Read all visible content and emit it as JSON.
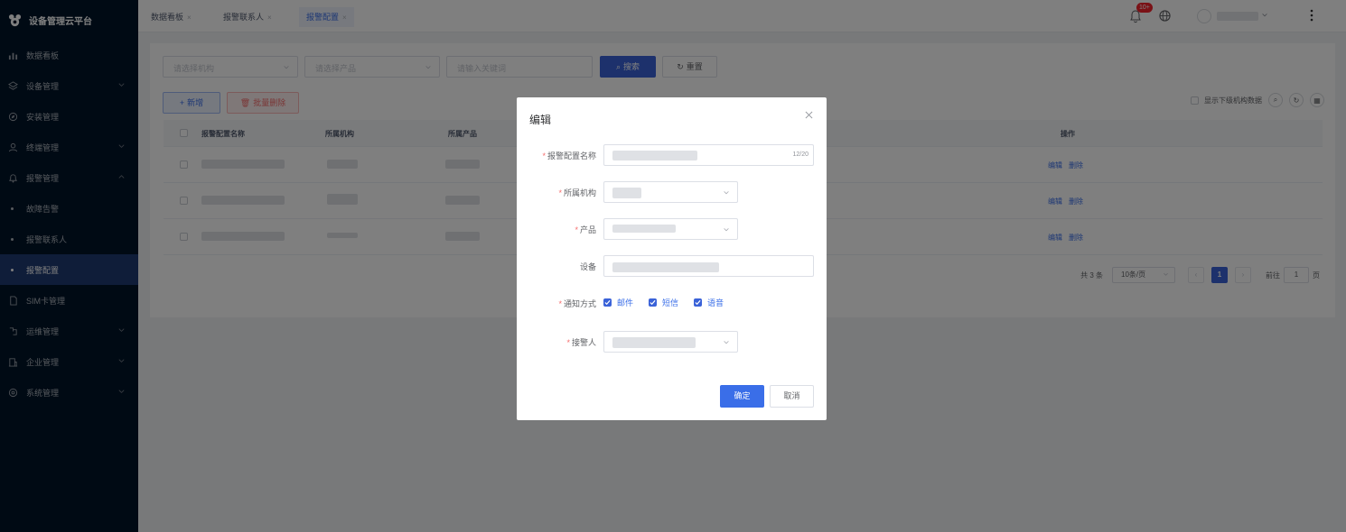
{
  "app": {
    "title": "设备管理云平台"
  },
  "sidebar": {
    "items": [
      {
        "label": "数据看板",
        "icon": "bar-chart-icon",
        "has_children": false
      },
      {
        "label": "设备管理",
        "icon": "layers-icon",
        "has_children": true
      },
      {
        "label": "安装管理",
        "icon": "compass-icon",
        "has_children": false
      },
      {
        "label": "终端管理",
        "icon": "user-icon",
        "has_children": true
      },
      {
        "label": "报警管理",
        "icon": "alarm-icon",
        "has_children": true,
        "expanded": true
      },
      {
        "label": "故障告警",
        "sub": true
      },
      {
        "label": "报警联系人",
        "sub": true
      },
      {
        "label": "报警配置",
        "sub": true,
        "active": true
      },
      {
        "label": "SIM卡管理",
        "icon": "sim-card-icon",
        "has_children": false
      },
      {
        "label": "运维管理",
        "icon": "tools-icon",
        "has_children": true
      },
      {
        "label": "企业管理",
        "icon": "building-icon",
        "has_children": true
      },
      {
        "label": "系统管理",
        "icon": "settings-icon",
        "has_children": true
      }
    ]
  },
  "tabs": [
    {
      "label": "数据看板",
      "active": false
    },
    {
      "label": "报警联系人",
      "active": false
    },
    {
      "label": "报警配置",
      "active": true
    }
  ],
  "header": {
    "notification_badge": "10+"
  },
  "filters": {
    "org_placeholder": "请选择机构",
    "product_placeholder": "请选择产品",
    "keyword_placeholder": "请输入关键词",
    "search_label": "搜索",
    "reset_label": "重置"
  },
  "toolbar": {
    "add_label": "新增",
    "batch_delete_label": "批量删除",
    "show_sub_org_label": "显示下级机构数据"
  },
  "table": {
    "columns": [
      "报警配置名称",
      "所属机构",
      "所属产品",
      "操作"
    ],
    "rows": [
      {
        "edit": "编辑",
        "delete": "删除"
      },
      {
        "edit": "编辑",
        "delete": "删除"
      },
      {
        "edit": "编辑",
        "delete": "删除"
      }
    ]
  },
  "pagination": {
    "total_text": "共 3 条",
    "page_size": "10条/页",
    "current_page": "1",
    "goto_prefix": "前往",
    "goto_value": "1",
    "goto_suffix": "页"
  },
  "dialog": {
    "title": "编辑",
    "fields": {
      "name_label": "报警配置名称",
      "name_counter": "12/20",
      "org_label": "所属机构",
      "product_label": "产品",
      "device_label": "设备",
      "notify_label": "通知方式",
      "receiver_label": "接警人"
    },
    "notify_options": [
      {
        "label": "邮件",
        "checked": true
      },
      {
        "label": "短信",
        "checked": true
      },
      {
        "label": "语音",
        "checked": true
      }
    ],
    "ok_label": "确定",
    "cancel_label": "取消"
  },
  "colors": {
    "primary": "#3a6ee8",
    "sidebar_bg": "#001529",
    "sidebar_active": "#1f3b72",
    "danger": "#f56c6c"
  }
}
